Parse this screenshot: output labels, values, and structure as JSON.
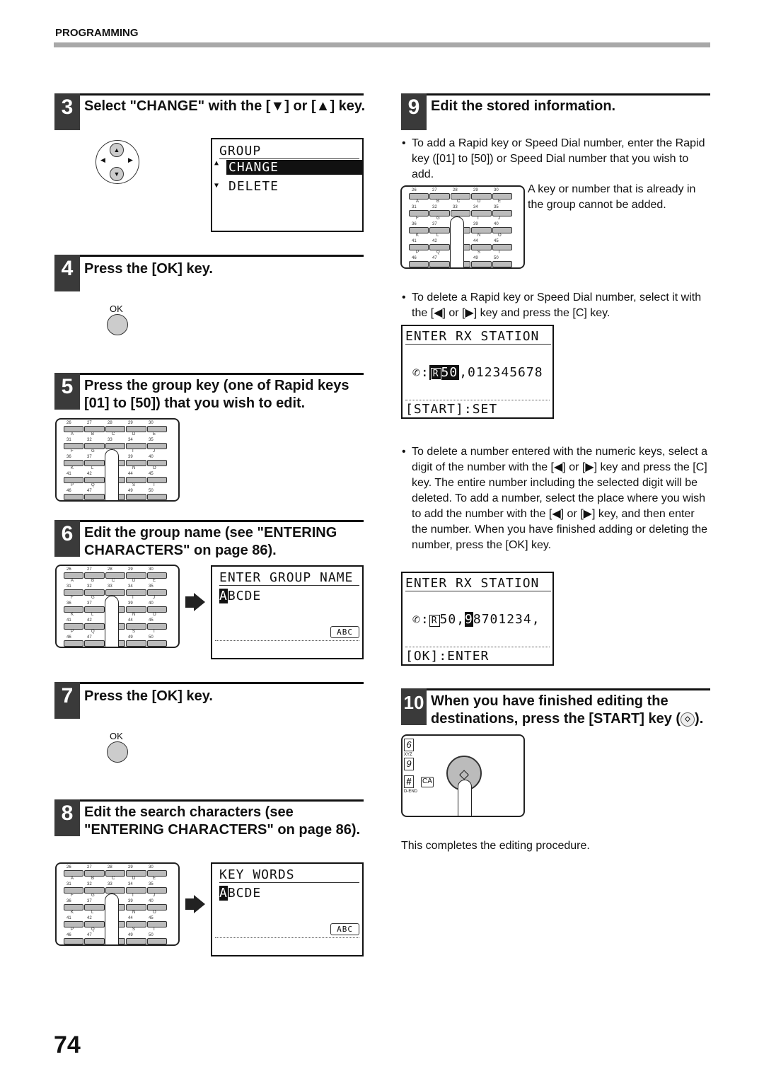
{
  "header": {
    "section": "PROGRAMMING"
  },
  "steps": {
    "s3": {
      "num": "3",
      "title": "Select \"CHANGE\" with the [▼] or [▲] key."
    },
    "s4": {
      "num": "4",
      "title": "Press the [OK] key."
    },
    "s5": {
      "num": "5",
      "title": "Press the group key (one of Rapid keys [01] to [50]) that you wish to edit."
    },
    "s6": {
      "num": "6",
      "title": "Edit the group name (see \"ENTERING CHARACTERS\" on page 86)."
    },
    "s7": {
      "num": "7",
      "title": "Press the [OK] key."
    },
    "s8": {
      "num": "8",
      "title": "Edit the search characters (see \"ENTERING CHARACTERS\" on page 86)."
    },
    "s9": {
      "num": "9",
      "title": "Edit the stored information."
    },
    "s10": {
      "num": "10",
      "title": [
        "When you have finished editing the destinations, press the [START] key (",
        ")."
      ]
    }
  },
  "lcd_group": {
    "title": "GROUP",
    "up": "▲",
    "down": "▼",
    "item1": "CHANGE",
    "item2": "DELETE"
  },
  "lcd_name": {
    "title": "ENTER GROUP NAME",
    "cursor": "A",
    "rest": "BCDE",
    "mode": "ABC"
  },
  "lcd_keywords": {
    "title": "KEY WORDS",
    "cursor": "A",
    "rest": "BCDE",
    "mode": "ABC"
  },
  "lcd_rx1": {
    "title": "ENTER RX STATION",
    "colon": ":",
    "r": "R",
    "sel": "50",
    "rest": ",012345678",
    "footer": "[START]:SET"
  },
  "lcd_rx2": {
    "title": "ENTER RX STATION",
    "colon": ":",
    "r": "R",
    "pre": "50,",
    "sel": "9",
    "rest": "8701234,",
    "footer": "[OK]:ENTER"
  },
  "ok_label": "OK",
  "bullets": {
    "b1": "To add a Rapid key or Speed Dial number, enter the Rapid key ([01] to [50]) or Speed Dial number that you wish to add.",
    "b1_note": "A key or number that is already in the group cannot be added.",
    "b2": "To delete a Rapid key or Speed Dial number, select it with the [◀] or [▶] key and press the [C] key.",
    "b3": "To delete a number entered with the numeric keys, select a digit of the number with the [◀] or [▶] key and press the [C] key. The entire number including the selected digit will be deleted. To add a number, select the place where you wish to add the number with the [◀] or [▶] key, and then enter the number. When you have finished adding or deleting the number, press the [OK] key."
  },
  "start_panel": {
    "k6": "6",
    "k9": "9",
    "khash": "#",
    "ca": "CA",
    "xyz": "XYZ",
    "dend": "D-END"
  },
  "completion": "This completes the editing procedure.",
  "page_number": "74",
  "keypad_labels": [
    [
      "26",
      "27",
      "28",
      "29",
      "30"
    ],
    [
      "A",
      "B",
      "C",
      "D",
      "E"
    ],
    [
      "31",
      "32",
      "33",
      "34",
      "35"
    ],
    [
      "F",
      "G",
      "H",
      "I",
      "J"
    ],
    [
      "36",
      "37",
      "38",
      "39",
      "40"
    ],
    [
      "K",
      "L",
      "M",
      "N",
      "O"
    ],
    [
      "41",
      "42",
      "43",
      "44",
      "45"
    ],
    [
      "P",
      "Q",
      "R",
      "S",
      "T"
    ],
    [
      "46",
      "47",
      "48",
      "49",
      "50"
    ]
  ]
}
